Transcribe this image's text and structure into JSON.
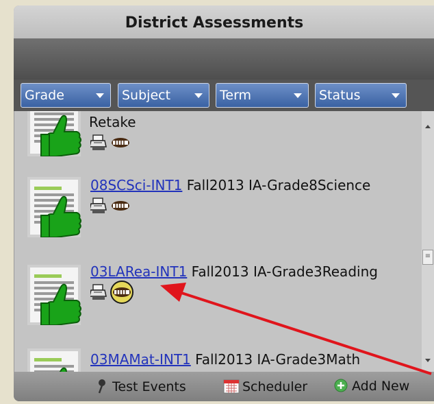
{
  "panel": {
    "title": "District Assessments"
  },
  "filters": [
    {
      "label": "Grade"
    },
    {
      "label": "Subject"
    },
    {
      "label": "Term"
    },
    {
      "label": "Status"
    }
  ],
  "items": [
    {
      "link": "",
      "text": "Retake"
    },
    {
      "link": "08SCSci-INT1",
      "text": " Fall2013 IA-Grade8Science"
    },
    {
      "link": "03LARea-INT1",
      "text": " Fall2013 IA-Grade3Reading"
    },
    {
      "link": "03MAMat-INT1",
      "text": " Fall2013 IA-Grade3Math"
    }
  ],
  "footer": {
    "test_events": "Test Events",
    "scheduler": "Scheduler",
    "add_new": "Add New"
  },
  "colors": {
    "filter_blue": "#3a62a3",
    "link": "#2233bb",
    "highlight_circle": "#e5d85a",
    "annotation_arrow": "#e0151c",
    "thumb_green": "#19a319"
  },
  "icons": [
    "expand-icon",
    "print-icon",
    "assessment-pill-icon",
    "pin-icon",
    "calendar-icon",
    "plus-circle-icon",
    "chevron-down-icon",
    "thumbs-up-document-icon"
  ]
}
